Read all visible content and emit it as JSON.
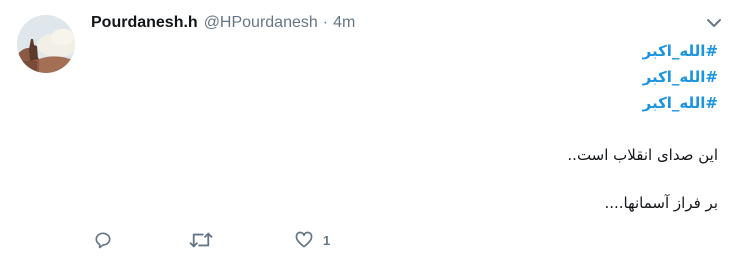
{
  "tweet": {
    "display_name": "Pourdanesh.h",
    "handle": "@HPourdanesh",
    "separator": "·",
    "time": "4m",
    "hashtags": [
      "#الله_اکبر",
      "#الله_اکبر",
      "#الله_اکبر"
    ],
    "text_lines": [
      "این صدای انقلاب است..",
      "بر فراز آسمانها...."
    ],
    "like_count": "1"
  },
  "icons": {
    "caret": "chevron-down-icon",
    "reply": "reply-icon",
    "retweet": "retweet-icon",
    "like": "heart-icon"
  },
  "colors": {
    "hashtag": "#1b95e0",
    "name": "#14171a",
    "meta": "#657786",
    "icon": "#657786"
  }
}
